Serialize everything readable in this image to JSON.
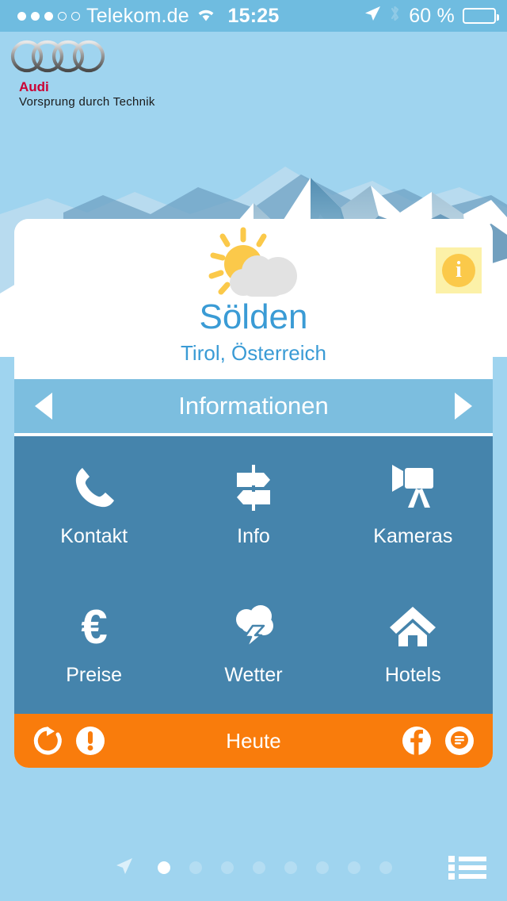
{
  "statusbar": {
    "signal_filled": 3,
    "signal_empty": 2,
    "carrier": "Telekom.de",
    "wifi_icon": "wifi-icon",
    "time": "15:25",
    "location_icon": "location-arrow-icon",
    "bluetooth_icon": "bluetooth-icon",
    "battery_percent": "60 %",
    "battery_level": 60
  },
  "brand": {
    "logo_icon": "audi-rings-icon",
    "name": "Audi",
    "slogan": "Vorsprung durch Technik",
    "name_color": "#CC0033"
  },
  "hero": {
    "background_icon": "mountain-range-illustration",
    "weather_icon": "sun-behind-cloud-icon",
    "info_badge_icon": "info-circle-icon",
    "info_badge_label": "i",
    "info_badge_bg": "#FCF1A8",
    "info_badge_circle": "#FBC94A"
  },
  "resort": {
    "name": "Sölden",
    "region": "Tirol, Österreich",
    "text_color": "#3A9BD5"
  },
  "navstrip": {
    "prev_icon": "arrow-left-icon",
    "title": "Informationen",
    "next_icon": "arrow-right-icon",
    "bg_color": "#7CBEDF"
  },
  "grid": {
    "bg_color": "#4584AC",
    "tiles": [
      {
        "label": "Kontakt",
        "icon": "phone-icon"
      },
      {
        "label": "Info",
        "icon": "signpost-icon"
      },
      {
        "label": "Kameras",
        "icon": "video-camera-icon"
      },
      {
        "label": "Preise",
        "icon": "euro-icon"
      },
      {
        "label": "Wetter",
        "icon": "cloud-lightning-icon"
      },
      {
        "label": "Hotels",
        "icon": "house-icon"
      }
    ]
  },
  "actionbar": {
    "bg_color": "#F97C0C",
    "title": "Heute",
    "refresh_icon": "refresh-icon",
    "alert_icon": "alert-exclamation-icon",
    "facebook_icon": "facebook-icon",
    "chat_icon": "chat-bubble-icon"
  },
  "pager": {
    "location_icon": "location-arrow-icon",
    "total_pages": 8,
    "active_page": 1,
    "menu_icon": "list-menu-icon",
    "active_color": "#FFFFFF",
    "inactive_color": "#B4DDF2"
  },
  "theme": {
    "page_background": "#9FD4EF",
    "statusbar_background": "#6FBCE0"
  }
}
